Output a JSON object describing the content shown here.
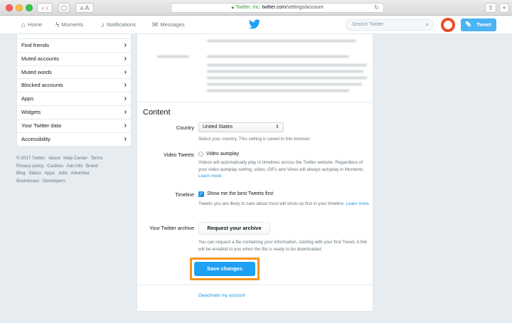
{
  "browser": {
    "address_secure_label": "Twitter, Inc.",
    "address_domain": "twitter.com",
    "address_path": "/settings/account",
    "font_small_label": "A",
    "font_large_label": "A"
  },
  "header": {
    "nav": [
      {
        "label": "Home",
        "icon": "home-icon"
      },
      {
        "label": "Moments",
        "icon": "lightning-icon"
      },
      {
        "label": "Notifications",
        "icon": "bell-icon"
      },
      {
        "label": "Messages",
        "icon": "envelope-icon"
      }
    ],
    "search_placeholder": "Search Twitter",
    "tweet_label": "Tweet",
    "brand_color": "#1da1f2"
  },
  "sidebar": {
    "items": [
      {
        "label": "Find friends"
      },
      {
        "label": "Muted accounts"
      },
      {
        "label": "Muted words"
      },
      {
        "label": "Blocked accounts"
      },
      {
        "label": "Apps"
      },
      {
        "label": "Widgets"
      },
      {
        "label": "Your Twitter data"
      },
      {
        "label": "Accessibility"
      }
    ],
    "footer_links": [
      "© 2017 Twitter",
      "About",
      "Help Center",
      "Terms",
      "Privacy policy",
      "Cookies",
      "Ads info",
      "Brand",
      "Blog",
      "Status",
      "Apps",
      "Jobs",
      "Advertise",
      "Businesses",
      "Developers"
    ]
  },
  "main": {
    "content_heading": "Content",
    "country": {
      "label": "Country",
      "value": "United States",
      "help": "Select your country. This setting is saved to this browser."
    },
    "video_tweets": {
      "label": "Video Tweets",
      "option": "Video autoplay",
      "checked": false,
      "help": "Videos will automatically play in timelines across the Twitter website. Regardless of your video autoplay setting, video, GIFs and Vines will always autoplay in Moments.",
      "learn_more": "Learn more."
    },
    "timeline": {
      "label": "Timeline",
      "option": "Show me the best Tweets first",
      "checked": true,
      "help": "Tweets you are likely to care about most will show up first in your timeline.",
      "learn_more": "Learn more."
    },
    "archive": {
      "label": "Your Twitter archive",
      "button": "Request your archive",
      "help": "You can request a file containing your information, starting with your first Tweet. A link will be emailed to you when the file is ready to be downloaded."
    },
    "save_button": "Save changes",
    "deactivate_link": "Deactivate my account",
    "highlight_color": "#f7941e"
  }
}
